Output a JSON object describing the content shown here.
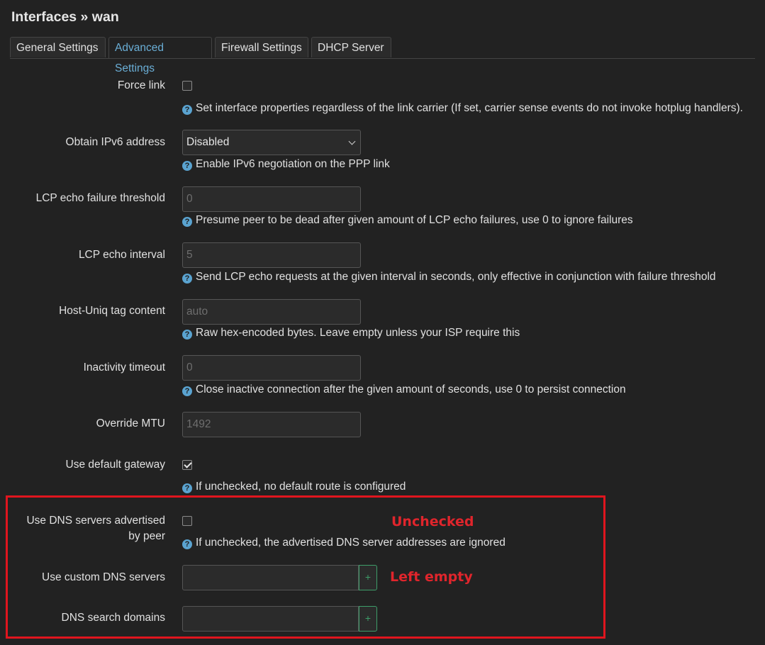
{
  "page": {
    "title": "Interfaces » wan"
  },
  "tabs": [
    {
      "label": "General Settings",
      "active": false
    },
    {
      "label": "Advanced Settings",
      "active": true
    },
    {
      "label": "Firewall Settings",
      "active": false
    },
    {
      "label": "DHCP Server",
      "active": false
    }
  ],
  "form": {
    "force_link": {
      "label": "Force link",
      "checked": false,
      "help": "Set interface properties regardless of the link carrier (If set, carrier sense events do not invoke hotplug handlers)."
    },
    "obtain_ipv6": {
      "label": "Obtain IPv6 address",
      "value": "Disabled",
      "help": "Enable IPv6 negotiation on the PPP link"
    },
    "lcp_threshold": {
      "label": "LCP echo failure threshold",
      "placeholder": "0",
      "help": "Presume peer to be dead after given amount of LCP echo failures, use 0 to ignore failures"
    },
    "lcp_interval": {
      "label": "LCP echo interval",
      "placeholder": "5",
      "help": "Send LCP echo requests at the given interval in seconds, only effective in conjunction with failure threshold"
    },
    "host_uniq": {
      "label": "Host-Uniq tag content",
      "placeholder": "auto",
      "help": "Raw hex-encoded bytes. Leave empty unless your ISP require this"
    },
    "inactivity": {
      "label": "Inactivity timeout",
      "placeholder": "0",
      "help": "Close inactive connection after the given amount of seconds, use 0 to persist connection"
    },
    "mtu": {
      "label": "Override MTU",
      "placeholder": "1492"
    },
    "default_gw": {
      "label": "Use default gateway",
      "checked": true,
      "help": "If unchecked, no default route is configured"
    },
    "peer_dns": {
      "label_line1": "Use DNS servers advertised",
      "label_line2": "by peer",
      "checked": false,
      "help": "If unchecked, the advertised DNS server addresses are ignored"
    },
    "custom_dns": {
      "label": "Use custom DNS servers",
      "value": "",
      "add_symbol": "+"
    },
    "search_domains": {
      "label": "DNS search domains",
      "value": "",
      "add_symbol": "+"
    }
  },
  "help_icon_glyph": "?",
  "annotations": {
    "unchecked": "Unchecked",
    "left_empty": "Left empty",
    "color": "#e0151e"
  }
}
